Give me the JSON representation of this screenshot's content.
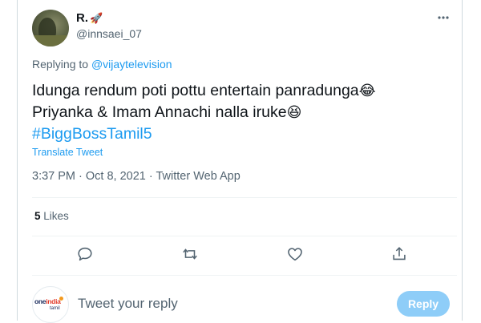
{
  "tweet": {
    "author_name": "R.",
    "author_badge": "🚀",
    "author_handle": "@innsaei_07",
    "more_icon": "more-dots-icon",
    "replying_prefix": "Replying to",
    "replying_to": "@vijaytelevision",
    "text_line1": "Idunga rendum poti pottu entertain panradunga",
    "emoji1": "😂",
    "text_line2": "Priyanka & Imam Annachi nalla iruke",
    "emoji2": "😆",
    "hashtag": "#BiggBossTamil5",
    "translate_label": "Translate Tweet",
    "timestamp": "3:37 PM · Oct 8, 2021 · Twitter Web App",
    "likes_count": "5",
    "likes_label": "Likes"
  },
  "actions": {
    "reply_icon": "reply-icon",
    "retweet_icon": "retweet-icon",
    "like_icon": "heart-icon",
    "share_icon": "share-icon"
  },
  "composer": {
    "logo_one": "one",
    "logo_india": "india",
    "logo_tamil": "tamil",
    "placeholder": "Tweet your reply",
    "reply_button": "Reply"
  },
  "colors": {
    "accent": "#1d9bf0",
    "secondary_text": "#536471",
    "reply_button_disabled": "#8ecdf8"
  }
}
